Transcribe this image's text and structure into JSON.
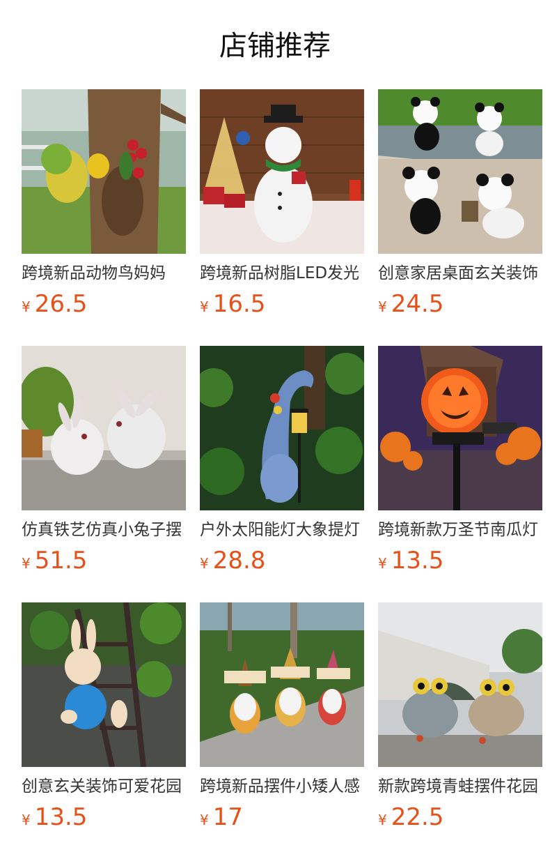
{
  "page": {
    "title": "店铺推荐"
  },
  "colors": {
    "price": "#e8501a",
    "title": "#111111",
    "text": "#333333"
  },
  "products": [
    {
      "name": "跨境新品动物鸟妈妈",
      "currency": "¥",
      "price": "26.5",
      "image": "woodpecker-birds-on-tree-photo"
    },
    {
      "name": "跨境新品树脂LED发光",
      "currency": "¥",
      "price": "16.5",
      "image": "snowman-figurine-photo"
    },
    {
      "name": "创意家居桌面玄关装饰",
      "currency": "¥",
      "price": "24.5",
      "image": "panda-figurines-photo"
    },
    {
      "name": "仿真铁艺仿真小兔子摆",
      "currency": "¥",
      "price": "51.5",
      "image": "white-rabbits-photo"
    },
    {
      "name": "户外太阳能灯大象提灯",
      "currency": "¥",
      "price": "28.8",
      "image": "elephant-solar-lantern-photo"
    },
    {
      "name": "跨境新款万圣节南瓜灯",
      "currency": "¥",
      "price": "13.5",
      "image": "halloween-pumpkin-lamp-photo"
    },
    {
      "name": "创意玄关装饰可爱花园",
      "currency": "¥",
      "price": "13.5",
      "image": "climbing-rabbit-photo"
    },
    {
      "name": "跨境新品摆件小矮人感",
      "currency": "¥",
      "price": "17",
      "image": "gnome-figurines-photo"
    },
    {
      "name": "新款跨境青蛙摆件花园",
      "currency": "¥",
      "price": "22.5",
      "image": "frog-figurines-photo"
    }
  ]
}
